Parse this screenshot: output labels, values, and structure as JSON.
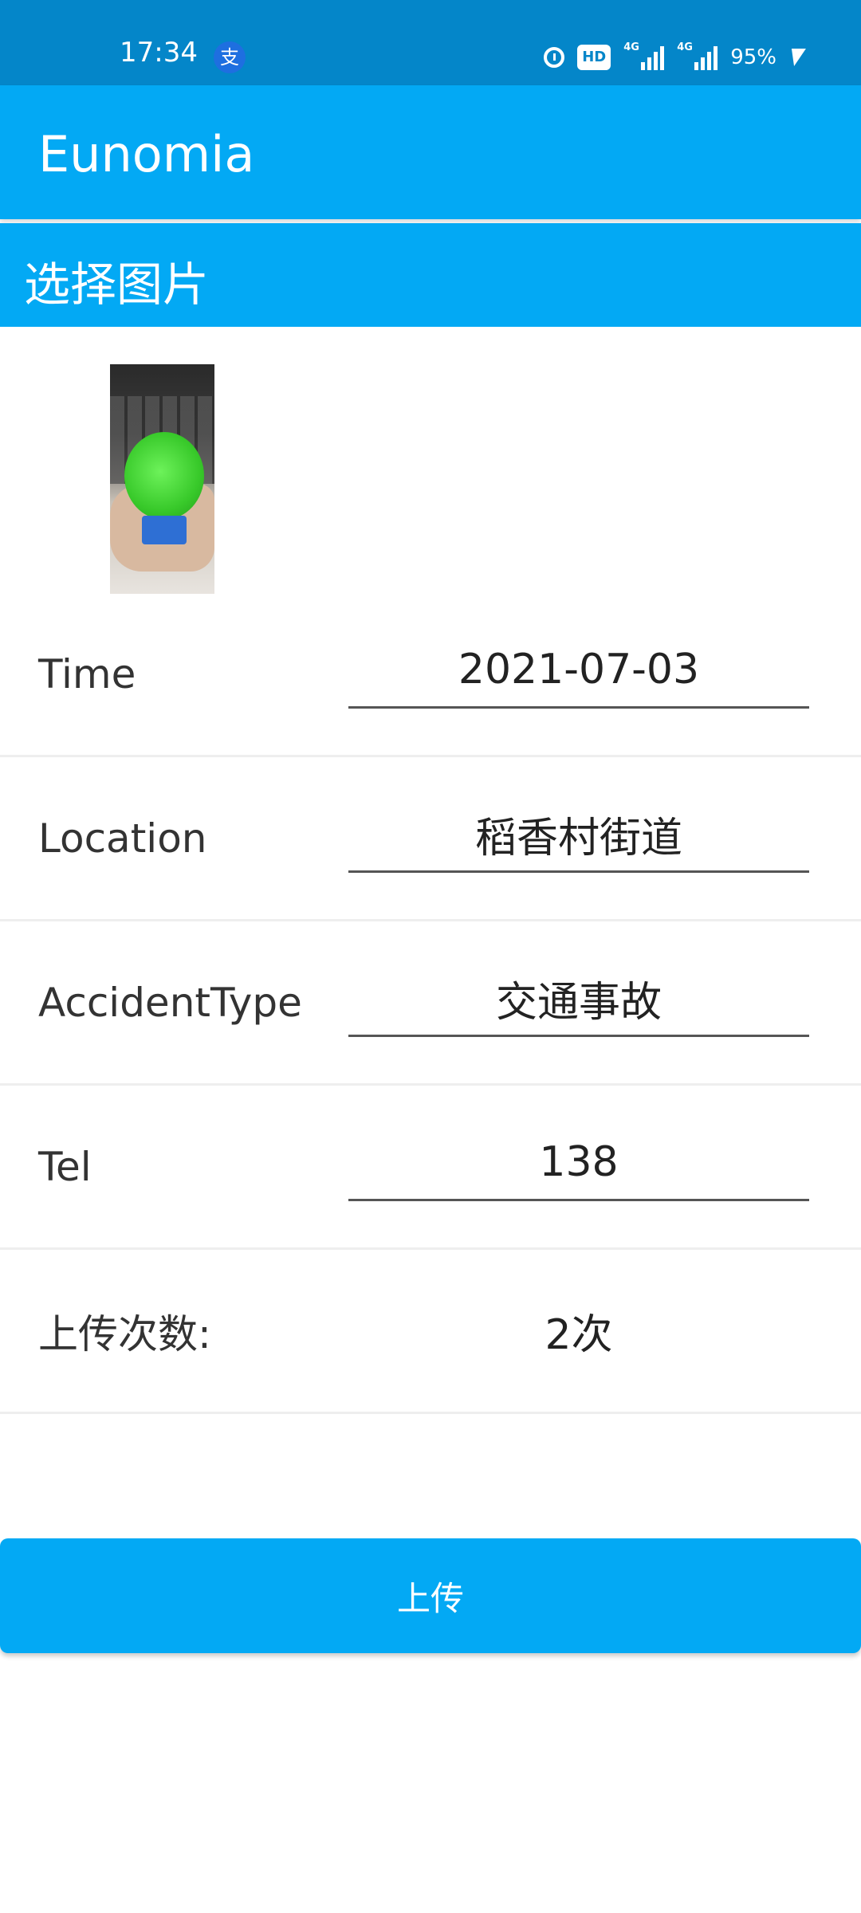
{
  "status_bar": {
    "time": "17:34",
    "alipay_glyph": "支",
    "hd_label": "HD",
    "signal1_tag": "4G",
    "signal2_tag": "4G",
    "battery_text": "95%"
  },
  "app_bar": {
    "title": "Eunomia"
  },
  "select_image": {
    "label": "选择图片"
  },
  "form": {
    "time": {
      "label": "Time",
      "value": "2021-07-03"
    },
    "location": {
      "label": "Location",
      "value": "稻香村街道"
    },
    "accident_type": {
      "label": "AccidentType",
      "value": "交通事故"
    },
    "tel": {
      "label": "Tel",
      "value": "138"
    },
    "upload_count": {
      "label": "上传次数:",
      "value": "2次"
    }
  },
  "upload_button": {
    "label": "上传"
  },
  "colors": {
    "status_bar": "#0486c9",
    "primary": "#03a9f4",
    "text": "#333333"
  },
  "icons": [
    "alipay-icon",
    "alarm-icon",
    "hd-voice-icon",
    "signal-4g-icon",
    "battery-charging-icon"
  ]
}
